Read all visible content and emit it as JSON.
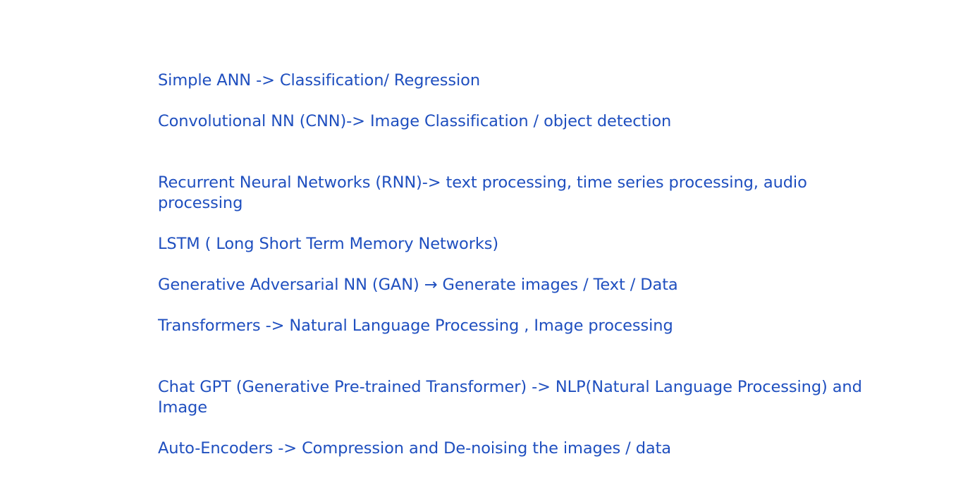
{
  "colors": {
    "text": "#1f4fbf",
    "background": "#ffffff"
  },
  "lines": [
    "Simple ANN -> Classification/ Regression",
    "Convolutional NN (CNN)-> Image Classification / object detection",
    "Recurrent Neural Networks (RNN)-> text processing, time series processing, audio processing",
    "LSTM ( Long Short Term Memory Networks)",
    "Generative Adversarial NN (GAN) → Generate images / Text / Data",
    "Transformers -> Natural Language Processing , Image processing",
    "Chat GPT (Generative Pre-trained Transformer) -> NLP(Natural Language Processing) and Image",
    "Auto-Encoders -> Compression and De-noising the images / data"
  ]
}
